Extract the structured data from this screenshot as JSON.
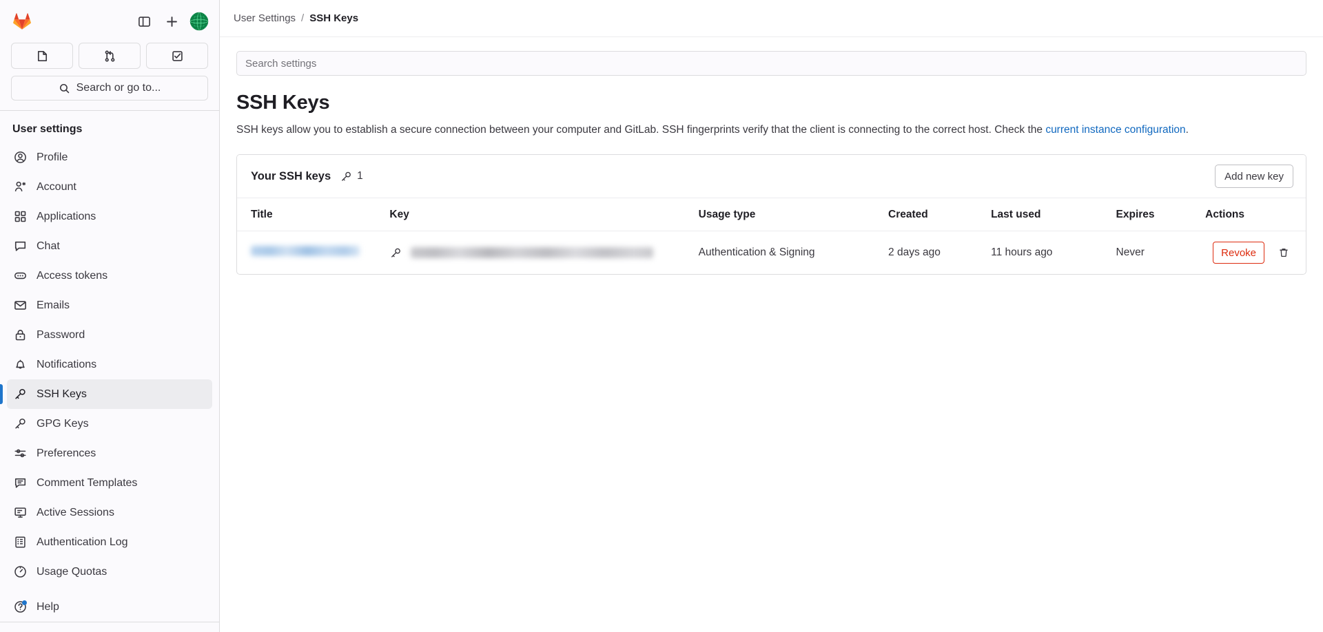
{
  "sidebar": {
    "logo": "gitlab-logo",
    "top_actions": [
      {
        "name": "toggle-sidebar-button",
        "icon": "panel-toggle-icon"
      },
      {
        "name": "create-new-button",
        "icon": "plus-icon"
      },
      {
        "name": "user-avatar-button",
        "icon": "avatar-icon"
      }
    ],
    "quick_actions": [
      {
        "name": "issues-button",
        "icon": "issues-icon"
      },
      {
        "name": "merge-requests-button",
        "icon": "merge-request-icon"
      },
      {
        "name": "todos-button",
        "icon": "todo-check-icon"
      }
    ],
    "search_label": "Search or go to...",
    "section_title": "User settings",
    "items": [
      {
        "label": "Profile",
        "icon": "profile-icon",
        "active": false
      },
      {
        "label": "Account",
        "icon": "account-icon",
        "active": false
      },
      {
        "label": "Applications",
        "icon": "applications-icon",
        "active": false
      },
      {
        "label": "Chat",
        "icon": "chat-icon",
        "active": false
      },
      {
        "label": "Access tokens",
        "icon": "token-icon",
        "active": false
      },
      {
        "label": "Emails",
        "icon": "email-icon",
        "active": false
      },
      {
        "label": "Password",
        "icon": "lock-icon",
        "active": false
      },
      {
        "label": "Notifications",
        "icon": "bell-icon",
        "active": false
      },
      {
        "label": "SSH Keys",
        "icon": "key-icon",
        "active": true
      },
      {
        "label": "GPG Keys",
        "icon": "key-icon",
        "active": false
      },
      {
        "label": "Preferences",
        "icon": "preferences-icon",
        "active": false
      },
      {
        "label": "Comment Templates",
        "icon": "comment-icon",
        "active": false
      },
      {
        "label": "Active Sessions",
        "icon": "monitor-icon",
        "active": false
      },
      {
        "label": "Authentication Log",
        "icon": "log-icon",
        "active": false
      },
      {
        "label": "Usage Quotas",
        "icon": "quota-icon",
        "active": false
      }
    ],
    "help_label": "Help"
  },
  "breadcrumb": {
    "parent": "User Settings",
    "separator": "/",
    "current": "SSH Keys"
  },
  "search": {
    "placeholder": "Search settings",
    "value": ""
  },
  "page": {
    "title": "SSH Keys",
    "description_part1": "SSH keys allow you to establish a secure connection between your computer and GitLab. SSH fingerprints verify that the client is connecting to the correct host. Check the ",
    "description_link": "current instance configuration",
    "description_part2": "."
  },
  "card": {
    "title": "Your SSH keys",
    "count": "1",
    "count_icon": "key-icon",
    "add_button": "Add new key"
  },
  "table": {
    "columns": [
      "Title",
      "Key",
      "Usage type",
      "Created",
      "Last used",
      "Expires",
      "Actions"
    ],
    "rows": [
      {
        "title": "",
        "title_redacted": true,
        "key": "",
        "key_redacted": true,
        "key_icon": "key-icon",
        "usage_type": "Authentication & Signing",
        "created": "2 days ago",
        "last_used": "11 hours ago",
        "expires": "Never",
        "revoke_label": "Revoke",
        "delete_icon": "trash-icon"
      }
    ]
  },
  "colors": {
    "accent": "#1f75cb",
    "link": "#1068bf",
    "danger": "#dd2b0e",
    "sidebar_bg": "#fbfafd",
    "border": "#dcdcde"
  }
}
